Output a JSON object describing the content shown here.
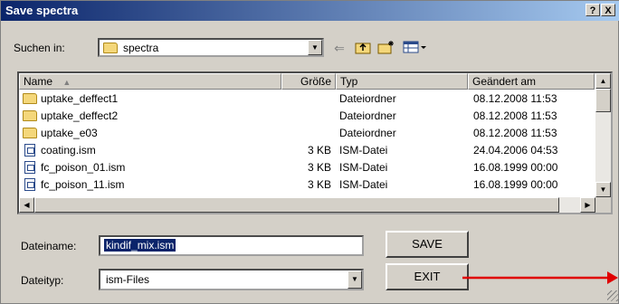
{
  "window": {
    "title": "Save spectra",
    "help_label": "?",
    "close_label": "X"
  },
  "lookin": {
    "label": "Suchen in:",
    "value": "spectra"
  },
  "toolbar": {
    "back_glyph": "⇐"
  },
  "columns": {
    "name": "Name",
    "size": "Größe",
    "type": "Typ",
    "modified": "Geändert am"
  },
  "files": [
    {
      "icon": "folder",
      "name": "uptake_deffect1",
      "size": "",
      "type": "Dateiordner",
      "modified": "08.12.2008 11:53"
    },
    {
      "icon": "folder",
      "name": "uptake_deffect2",
      "size": "",
      "type": "Dateiordner",
      "modified": "08.12.2008 11:53"
    },
    {
      "icon": "folder",
      "name": "uptake_e03",
      "size": "",
      "type": "Dateiordner",
      "modified": "08.12.2008 11:53"
    },
    {
      "icon": "file",
      "name": "coating.ism",
      "size": "3 KB",
      "type": "ISM-Datei",
      "modified": "24.04.2006 04:53"
    },
    {
      "icon": "file",
      "name": "fc_poison_01.ism",
      "size": "3 KB",
      "type": "ISM-Datei",
      "modified": "16.08.1999 00:00"
    },
    {
      "icon": "file",
      "name": "fc_poison_11.ism",
      "size": "3 KB",
      "type": "ISM-Datei",
      "modified": "16.08.1999 00:00"
    }
  ],
  "filename": {
    "label": "Dateiname:",
    "value": "kindif_mix.ism"
  },
  "filetype": {
    "label": "Dateityp:",
    "value": "ism-Files"
  },
  "buttons": {
    "save": "SAVE",
    "exit": "EXIT"
  },
  "colors": {
    "annotation_arrow": "#e00000",
    "title_gradient_start": "#0a246a"
  }
}
